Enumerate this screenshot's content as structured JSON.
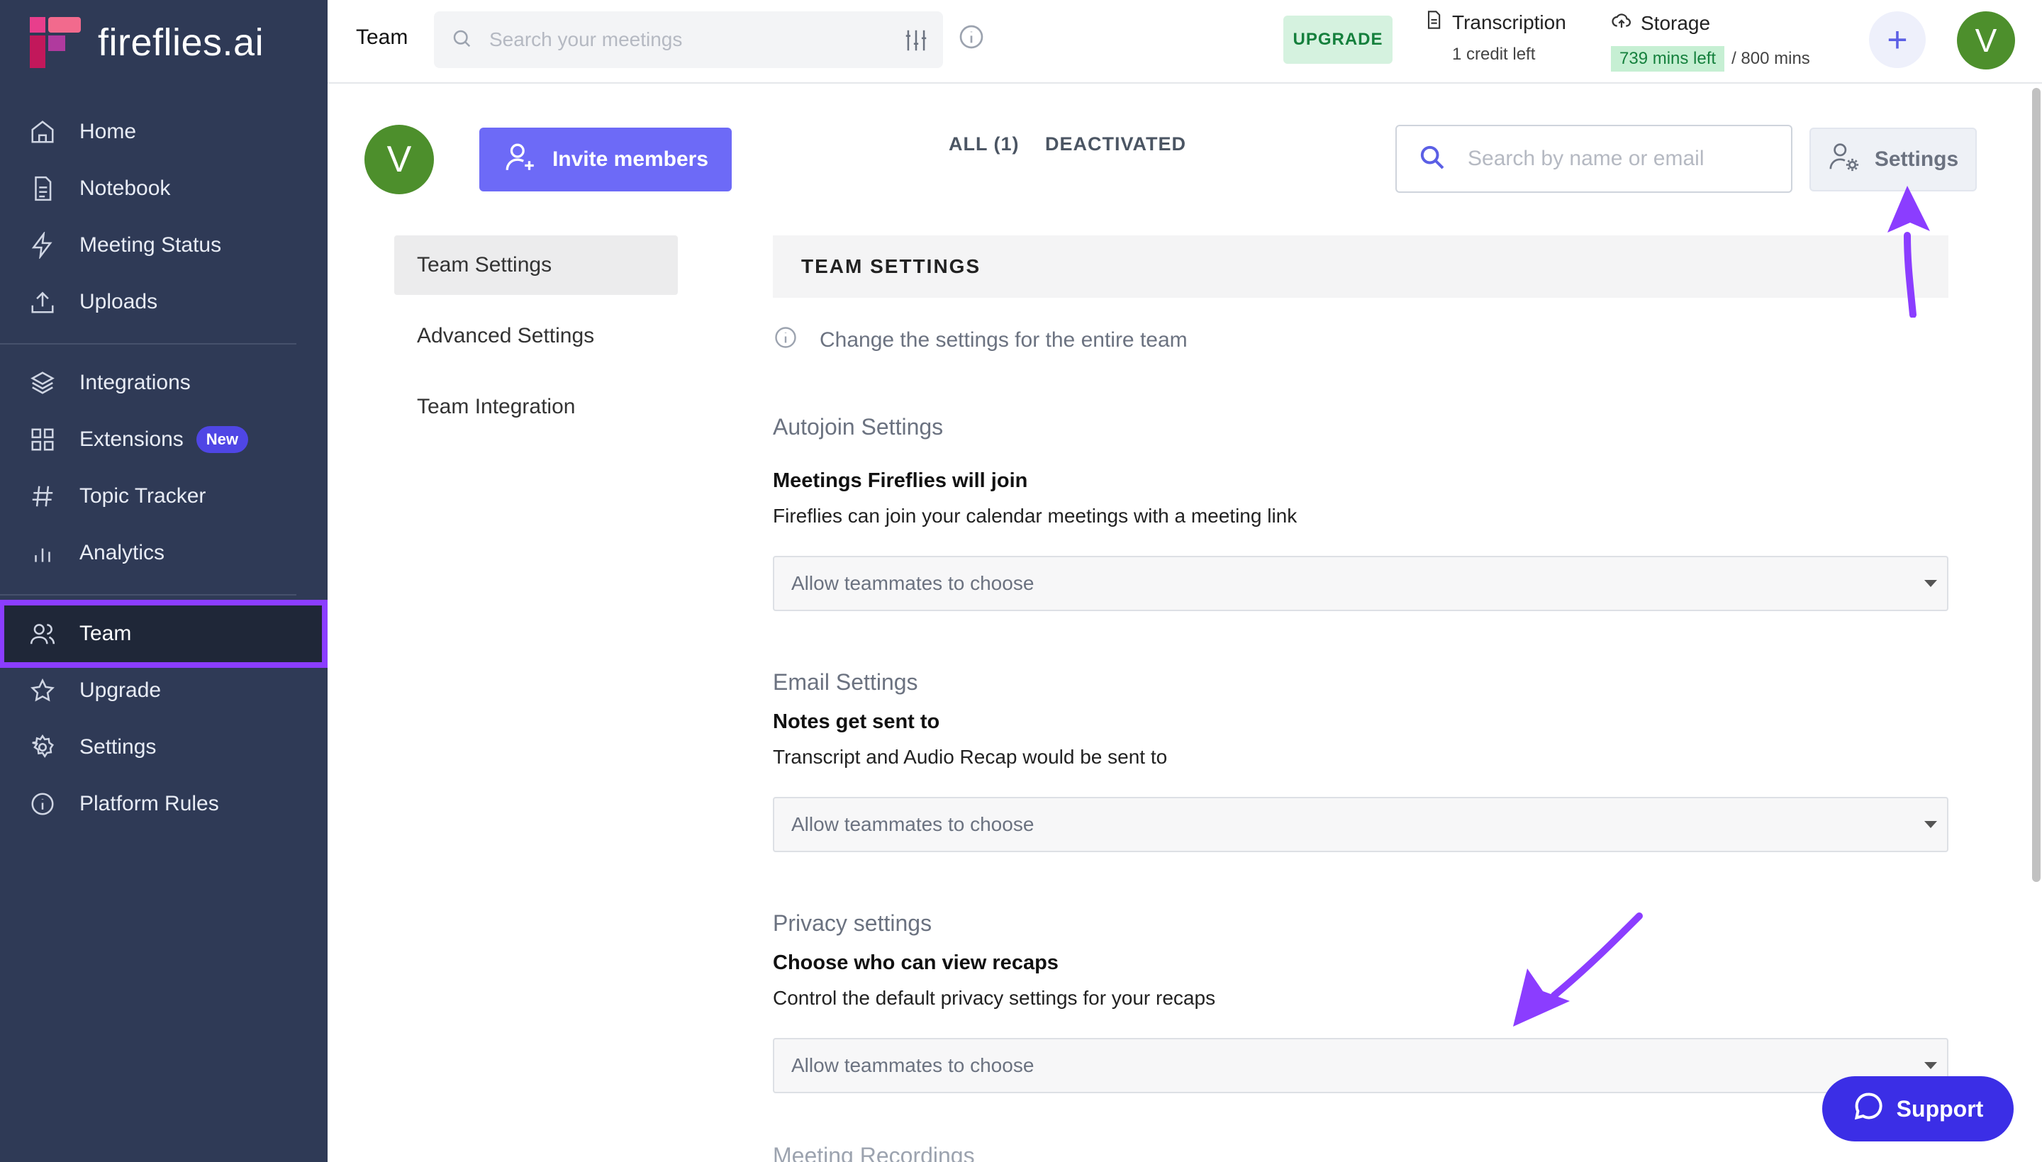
{
  "app": {
    "brand_name": "fireflies.ai"
  },
  "colors": {
    "sidebar_bg": "#2f3a56",
    "accent": "#6d6af7",
    "highlight": "#8b3dff",
    "avatar": "#4d8f2c",
    "upgrade_bg": "#d5f2df"
  },
  "sidebar": {
    "items": [
      {
        "label": "Home",
        "icon": "home-icon"
      },
      {
        "label": "Notebook",
        "icon": "notebook-icon"
      },
      {
        "label": "Meeting Status",
        "icon": "lightning-icon"
      },
      {
        "label": "Uploads",
        "icon": "upload-icon"
      },
      {
        "label": "Integrations",
        "icon": "layers-icon"
      },
      {
        "label": "Extensions",
        "icon": "grid-icon",
        "badge": "New"
      },
      {
        "label": "Topic Tracker",
        "icon": "hash-icon"
      },
      {
        "label": "Analytics",
        "icon": "bar-chart-icon"
      },
      {
        "label": "Team",
        "icon": "users-icon",
        "active": true
      },
      {
        "label": "Upgrade",
        "icon": "star-icon"
      },
      {
        "label": "Settings",
        "icon": "gear-icon"
      },
      {
        "label": "Platform Rules",
        "icon": "info-icon"
      }
    ]
  },
  "topbar": {
    "title": "Team",
    "search_placeholder": "Search your meetings",
    "upgrade_label": "UPGRADE",
    "transcription_title": "Transcription",
    "transcription_sub": "1 credit left",
    "storage_title": "Storage",
    "storage_left": "739 mins left",
    "storage_total": "/ 800 mins",
    "plus_label": "+",
    "avatar_initial": "V"
  },
  "team_toolbar": {
    "avatar_initial": "V",
    "invite_label": "Invite members",
    "tab_all": "ALL (1)",
    "tab_deactivated": "DEACTIVATED",
    "member_search_placeholder": "Search by name or email",
    "settings_label": "Settings"
  },
  "settings_menu": [
    {
      "label": "Team Settings",
      "active": true
    },
    {
      "label": "Advanced Settings"
    },
    {
      "label": "Team Integration"
    }
  ],
  "content": {
    "header": "TEAM SETTINGS",
    "hint": "Change the settings for the entire team",
    "autojoin": {
      "group": "Autojoin Settings",
      "title": "Meetings Fireflies will join",
      "desc": "Fireflies can join your calendar meetings with a meeting link",
      "value": "Allow teammates to choose"
    },
    "email": {
      "group": "Email Settings",
      "title": "Notes get sent to",
      "desc": "Transcript and Audio Recap would be sent to",
      "value": "Allow teammates to choose"
    },
    "privacy": {
      "group": "Privacy settings",
      "title": "Choose who can view recaps",
      "desc": "Control the default privacy settings for your recaps",
      "value": "Allow teammates to choose"
    },
    "next_group_partial": "Meeting Recordings"
  },
  "support": {
    "label": "Support"
  }
}
